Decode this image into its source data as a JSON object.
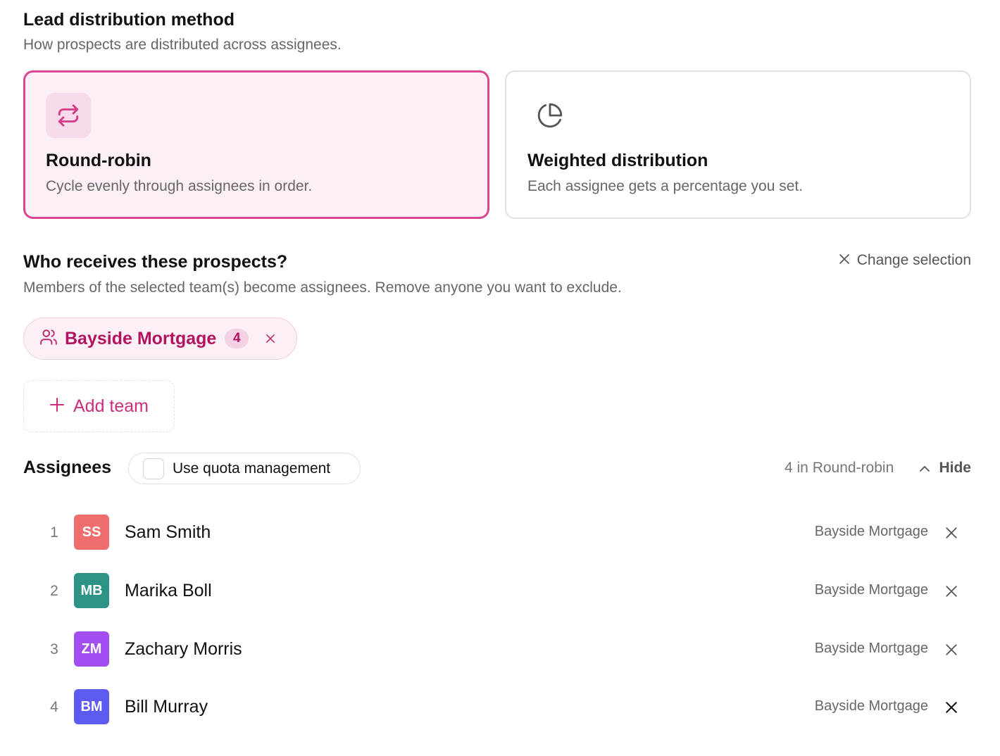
{
  "method": {
    "title": "Lead distribution method",
    "subtitle": "How prospects are distributed across assignees.",
    "options": [
      {
        "title": "Round-robin",
        "description": "Cycle evenly through assignees in order.",
        "icon": "repeat-icon",
        "selected": true
      },
      {
        "title": "Weighted distribution",
        "description": "Each assignee gets a percentage you set.",
        "icon": "pie-chart-icon",
        "selected": false
      }
    ]
  },
  "recipients": {
    "title": "Who receives these prospects?",
    "subtitle": "Members of the selected team(s) become assignees. Remove anyone you want to exclude.",
    "change_selection_label": "Change selection",
    "teams": [
      {
        "name": "Bayside Mortgage",
        "count": "4"
      }
    ],
    "add_team_label": "Add team"
  },
  "assignees": {
    "title": "Assignees",
    "quota_label": "Use quota management",
    "quota_checked": false,
    "summary": "4 in Round-robin",
    "hide_label": "Hide",
    "list": [
      {
        "index": "1",
        "initials": "SS",
        "name": "Sam Smith",
        "team": "Bayside Mortgage",
        "color": "#ee6d6d"
      },
      {
        "index": "2",
        "initials": "MB",
        "name": "Marika Boll",
        "team": "Bayside Mortgage",
        "color": "#2e9384"
      },
      {
        "index": "3",
        "initials": "ZM",
        "name": "Zachary Morris",
        "team": "Bayside Mortgage",
        "color": "#a24ef0"
      },
      {
        "index": "4",
        "initials": "BM",
        "name": "Bill Murray",
        "team": "Bayside Mortgage",
        "color": "#5e5cf0"
      }
    ]
  },
  "colors": {
    "accent": "#d94692",
    "accent_text": "#b3135e",
    "accent_bg": "#fcf0f6"
  }
}
